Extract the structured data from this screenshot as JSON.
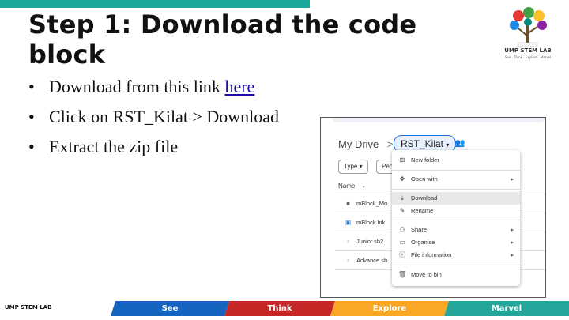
{
  "slide": {
    "title": "Step 1: Download the code block",
    "bullets": [
      {
        "text": "Download from this link ",
        "link": "here"
      },
      {
        "text": "Click on RST_Kilat > Download"
      },
      {
        "text": "Extract the zip file"
      }
    ]
  },
  "logo": {
    "name": "UMP STEM LAB",
    "tagline": "See · Think · Explore · Marvel"
  },
  "drive": {
    "breadcrumb": {
      "root": "My Drive",
      "separator": ">",
      "folder": "RST_Kilat"
    },
    "filters": [
      "Type",
      "Peo"
    ],
    "column_header": "Name",
    "files": [
      {
        "name": "mBlock_Mo",
        "icon": "folder-icon"
      },
      {
        "name": "mBlock.lnk",
        "icon": "link-file-icon"
      },
      {
        "name": "Junior.sb2",
        "icon": "file-icon"
      },
      {
        "name": "Advance.sb",
        "icon": "file-icon"
      }
    ],
    "menu": [
      {
        "label": "New folder",
        "icon": "new-folder-icon"
      },
      {
        "label": "Open with",
        "icon": "open-with-icon",
        "submenu": true
      },
      {
        "label": "Download",
        "icon": "download-icon",
        "highlighted": true
      },
      {
        "label": "Rename",
        "icon": "rename-icon"
      },
      {
        "label": "Share",
        "icon": "share-icon",
        "submenu": true
      },
      {
        "label": "Organise",
        "icon": "organise-icon",
        "submenu": true
      },
      {
        "label": "File information",
        "icon": "info-icon",
        "submenu": true
      },
      {
        "label": "Move to bin",
        "icon": "trash-icon"
      }
    ]
  },
  "footer": {
    "brand": "UMP STEM LAB",
    "segments": [
      {
        "label": "See",
        "color": "#1565c0"
      },
      {
        "label": "Think",
        "color": "#c62828"
      },
      {
        "label": "Explore",
        "color": "#f9a825"
      },
      {
        "label": "Marvel",
        "color": "#26a69a"
      }
    ]
  },
  "colors": {
    "accent_topbar": "#1aa89c",
    "link": "#1a0dab"
  }
}
